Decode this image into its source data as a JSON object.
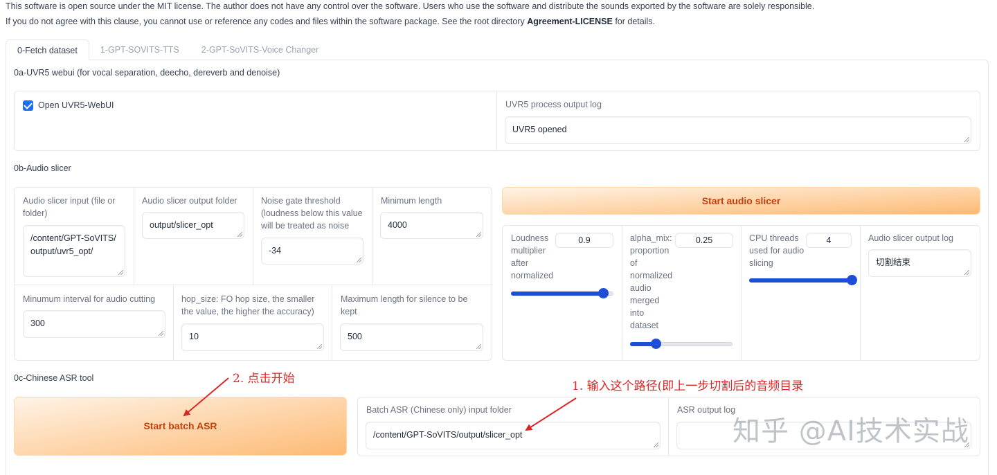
{
  "notice": {
    "line1": "This software is open source under the MIT license. The author does not have any control over the software. Users who use the software and distribute the sounds exported by the software are solely responsible.",
    "line2_prefix": "If you do not agree with this clause, you cannot use or reference any codes and files within the software package. See the root directory ",
    "line2_bold": "Agreement-LICENSE",
    "line2_suffix": " for details."
  },
  "tabs": [
    {
      "label": "0-Fetch dataset",
      "active": true
    },
    {
      "label": "1-GPT-SOVITS-TTS",
      "active": false
    },
    {
      "label": "2-GPT-SoVITS-Voice Changer",
      "active": false
    }
  ],
  "uvr5": {
    "section_title": "0a-UVR5 webui (for vocal separation, deecho, dereverb and denoise)",
    "checkbox_label": "Open UVR5-WebUI",
    "checkbox_checked": true,
    "log_label": "UVR5 process output log",
    "log_value": "UVR5 opened"
  },
  "slicer": {
    "section_title": "0b-Audio slicer",
    "input_label": "Audio slicer input (file or folder)",
    "input_value": "/content/GPT-SoVITS/output/uvr5_opt/",
    "output_folder_label": "Audio slicer output folder",
    "output_folder_value": "output/slicer_opt",
    "noise_gate_label": "Noise gate threshold (loudness below this value will be treated as noise",
    "noise_gate_value": "-34",
    "min_length_label": "Minimum length",
    "min_length_value": "4000",
    "min_interval_label": "Minumum interval for audio cutting",
    "min_interval_value": "300",
    "hop_size_label": "hop_size: FO hop size, the smaller the value, the higher the accuracy)",
    "hop_size_value": "10",
    "max_silence_label": "Maximum length for silence to be kept",
    "max_silence_value": "500",
    "start_button": "Start audio slicer",
    "loudness_label": "Loudness multiplier after normalized",
    "loudness_value": "0.9",
    "loudness_fraction": 0.9,
    "alpha_label": "alpha_mix: proportion of normalized audio merged into dataset",
    "alpha_value": "0.25",
    "alpha_fraction": 0.25,
    "threads_label": "CPU threads used for audio slicing",
    "threads_value": "4",
    "threads_fraction": 1.0,
    "log_label": "Audio slicer output log",
    "log_value": "切割结束"
  },
  "asr": {
    "section_title": "0c-Chinese ASR tool",
    "start_button": "Start batch ASR",
    "input_label": "Batch ASR (Chinese only) input folder",
    "input_value": "/content/GPT-SoVITS/output/slicer_opt",
    "log_label": "ASR output log",
    "log_value": ""
  },
  "annotations": {
    "step2": "2. 点击开始",
    "step1": "1. 输入这个路径(即上一步切割后的音频目录"
  },
  "watermark": "知乎 @AI技术实战",
  "colors": {
    "accent_blue": "#1d4ed8",
    "button_orange_text": "#c2410c",
    "annotation_red": "#dc2626"
  }
}
